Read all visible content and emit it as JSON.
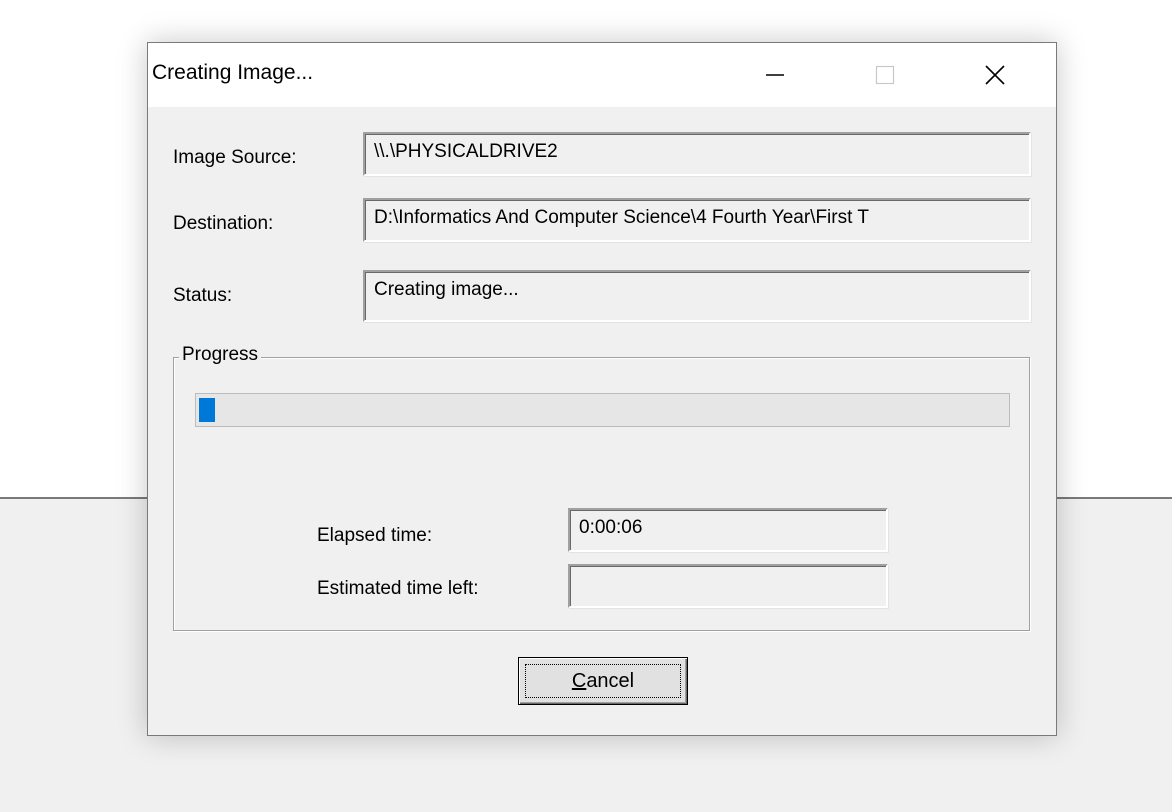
{
  "window": {
    "title": "Creating Image...",
    "icons": {
      "minimize": "minimize-icon",
      "maximize": "maximize-icon",
      "close": "close-icon"
    }
  },
  "fields": {
    "image_source": {
      "label": "Image Source:",
      "value": "\\\\.\\PHYSICALDRIVE2"
    },
    "destination": {
      "label": "Destination:",
      "value": "D:\\Informatics And Computer Science\\4 Fourth Year\\First T"
    },
    "status": {
      "label": "Status:",
      "value": "Creating image..."
    }
  },
  "progress": {
    "legend": "Progress",
    "fraction": 0.02,
    "color": "#0078d7",
    "elapsed_label": "Elapsed time:",
    "elapsed_value": "0:00:06",
    "estimated_label": "Estimated time left:",
    "estimated_value": ""
  },
  "buttons": {
    "cancel_mnemonic": "C",
    "cancel_rest": "ancel"
  }
}
